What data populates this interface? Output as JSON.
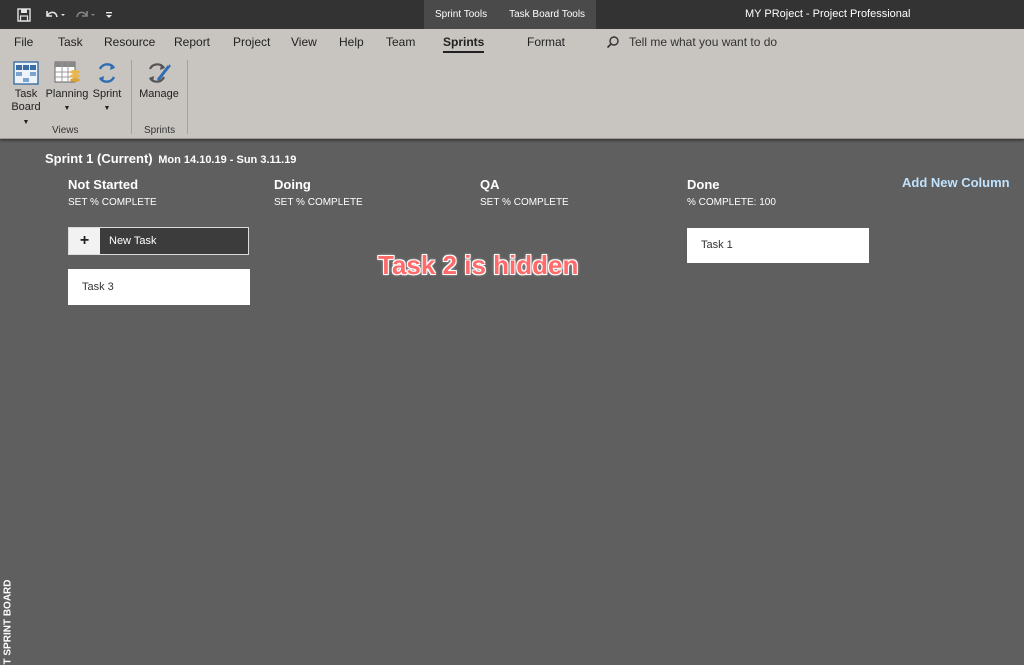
{
  "titlebar": {
    "quick_access": [
      "save-icon",
      "undo-icon",
      "redo-icon",
      "customize-icon"
    ],
    "contextual_tabs": [
      "Sprint Tools",
      "Task Board Tools"
    ],
    "app_title": "MY PRoject -  Project Professional"
  },
  "menu": {
    "items": [
      "File",
      "Task",
      "Resource",
      "Report",
      "Project",
      "View",
      "Help",
      "Team",
      "Sprints",
      "Format"
    ],
    "active": "Sprints",
    "search_text": "Tell me what you want to do"
  },
  "ribbon": {
    "buttons": {
      "task_board": {
        "line1": "Task",
        "line2": "Board"
      },
      "planning": "Planning",
      "sprint": "Sprint",
      "manage": "Manage"
    },
    "groups": {
      "views": "Views",
      "sprints": "Sprints"
    }
  },
  "board": {
    "sprint_name": "Sprint 1 (Current)",
    "sprint_dates": "Mon 14.10.19 - Sun 3.11.19",
    "add_column": "Add New Column",
    "columns": [
      {
        "title": "Not Started",
        "subtitle": "SET % COMPLETE"
      },
      {
        "title": "Doing",
        "subtitle": "SET % COMPLETE"
      },
      {
        "title": "QA",
        "subtitle": "SET % COMPLETE"
      },
      {
        "title": "Done",
        "subtitle": "% COMPLETE: 100"
      }
    ],
    "new_task_plus": "+",
    "new_task_label": "New Task",
    "cards": {
      "task3": "Task 3",
      "task1": "Task 1"
    },
    "side_label": "T SPRINT BOARD"
  },
  "annotation": "Task 2 is hidden",
  "colors": {
    "titlebar": "#333333",
    "ribbon": "#c8c5c1",
    "board": "#5f5f5f",
    "annotation": "#ff6b6b",
    "link": "#bfe3ff"
  }
}
